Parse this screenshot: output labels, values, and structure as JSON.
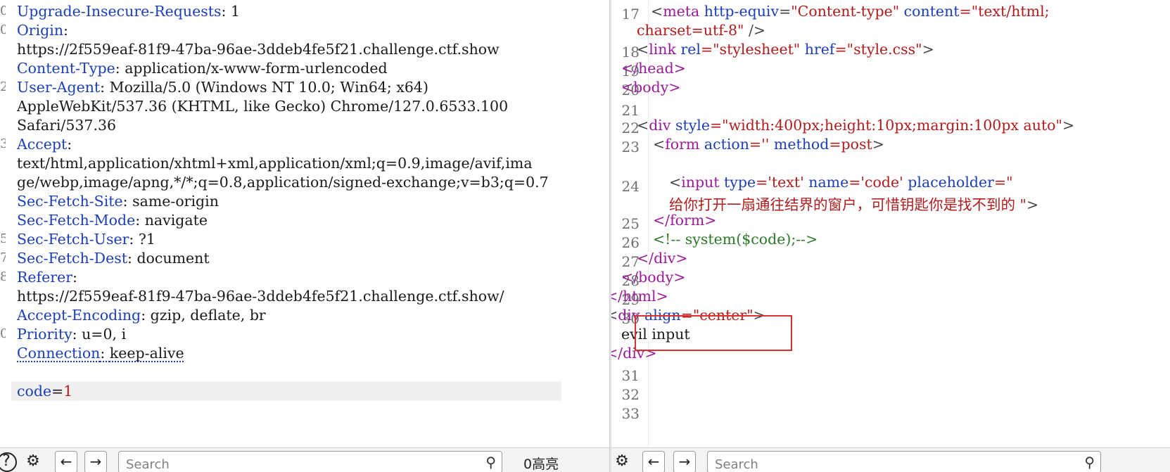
{
  "request": {
    "gutter_marks": [
      "0",
      "0",
      "",
      "",
      "2",
      "",
      "",
      "3",
      "",
      "",
      "",
      "",
      "5",
      "7",
      "8",
      "",
      "0",
      "",
      "",
      ""
    ],
    "lines": [
      {
        "key": "Upgrade-Insecure-Requests",
        "sep": ": ",
        "value": "1"
      },
      {
        "key": "Origin",
        "sep": ":",
        "value": ""
      },
      {
        "key": "",
        "sep": "",
        "value": "https://2f559eaf-81f9-47ba-96ae-3ddeb4fe5f21.challenge.ctf.show"
      },
      {
        "key": "Content-Type",
        "sep": ": ",
        "value": "application/x-www-form-urlencoded"
      },
      {
        "key": "User-Agent",
        "sep": ": ",
        "value": "Mozilla/5.0 (Windows NT 10.0; Win64; x64)"
      },
      {
        "key": "",
        "sep": "",
        "value": "AppleWebKit/537.36 (KHTML, like Gecko) Chrome/127.0.6533.100"
      },
      {
        "key": "",
        "sep": "",
        "value": "Safari/537.36"
      },
      {
        "key": "Accept",
        "sep": ":",
        "value": ""
      },
      {
        "key": "",
        "sep": "",
        "value": "text/html,application/xhtml+xml,application/xml;q=0.9,image/avif,ima"
      },
      {
        "key": "",
        "sep": "",
        "value": "ge/webp,image/apng,*/*;q=0.8,application/signed-exchange;v=b3;q=0.7"
      },
      {
        "key": "Sec-Fetch-Site",
        "sep": ": ",
        "value": "same-origin"
      },
      {
        "key": "Sec-Fetch-Mode",
        "sep": ": ",
        "value": "navigate"
      },
      {
        "key": "Sec-Fetch-User",
        "sep": ": ",
        "value": "?1"
      },
      {
        "key": "Sec-Fetch-Dest",
        "sep": ": ",
        "value": "document"
      },
      {
        "key": "Referer",
        "sep": ":",
        "value": ""
      },
      {
        "key": "",
        "sep": "",
        "value": "https://2f559eaf-81f9-47ba-96ae-3ddeb4fe5f21.challenge.ctf.show/"
      },
      {
        "key": "Accept-Encoding",
        "sep": ": ",
        "value": "gzip, deflate, br"
      },
      {
        "key": "Priority",
        "sep": ": ",
        "value": "u=0, i"
      },
      {
        "key": "Connection",
        "sep": ": ",
        "value": "keep-alive"
      }
    ],
    "body_key": "code",
    "body_eq": "=",
    "body_value": "1"
  },
  "response": {
    "line_numbers": [
      "17",
      "18",
      "19",
      "20",
      "21",
      "22",
      "23",
      "24",
      "25",
      "26",
      "27",
      "28",
      "29",
      "30",
      "31",
      "32",
      "33"
    ],
    "l17a_open": "<",
    "l17a_tag": "meta",
    "l17a_attr1": " http-equiv",
    "l17a_eq": "=",
    "l17a_val1": "\"Content-type\"",
    "l17a_attr2": " content",
    "l17a_val2": "=\"text/html;",
    "l17b_val": "charset=utf-8\"",
    "l17b_close": " />",
    "l18_open": "<",
    "l18_tag": "link",
    "l18_attr1": " rel",
    "l18_val1": "=\"stylesheet\"",
    "l18_attr2": " href",
    "l18_val2": "=\"style.css\"",
    "l18_close": ">",
    "l19": "</head>",
    "l20": "<body>",
    "l22_open": "<",
    "l22_tag": "div",
    "l22_attr": " style",
    "l22_val": "=\"width:400px;height:10px;margin:100px auto\"",
    "l22_close": ">",
    "l23_open": "<",
    "l23_tag": "form",
    "l23_attr1": " action",
    "l23_val1": "=''",
    "l23_attr2": " method",
    "l23_val2": "=post",
    "l23_close": ">",
    "l24a_open": "<",
    "l24a_tag": "input",
    "l24a_attr1": " type",
    "l24a_val1": "='text'",
    "l24a_attr2": " name",
    "l24a_val2": "='code'",
    "l24a_attr3": " placeholder",
    "l24a_val3": "=\"",
    "l24b_val": "给你打开一扇通往结界的窗户，可惜钥匙你是找不到的 \"",
    "l24b_close": ">",
    "l25": "</form>",
    "l26": "<!-- system($code);-->",
    "l27": "</div>",
    "l28": "</body>",
    "l29": "</html>",
    "l30_open": "<",
    "l30_tag": "div",
    "l30_attr": " align",
    "l30_val": "=\"center\"",
    "l30_close": ">",
    "l30_text": "evil input",
    "l30_end": "</div>"
  },
  "toolbar_left": {
    "help_icon": "question-icon",
    "settings_icon": "gear-icon",
    "back_label": "←",
    "forward_label": "→",
    "search_placeholder": "Search",
    "highlights": "0高亮"
  },
  "toolbar_right": {
    "back_label": "←",
    "forward_label": "→",
    "search_placeholder": "Search"
  },
  "colors": {
    "highlight_box": "#d93030",
    "tag": "#9a1b9a",
    "attr": "#1c3fb8",
    "string": "#b01c1c",
    "comment": "#2a7a2a"
  }
}
